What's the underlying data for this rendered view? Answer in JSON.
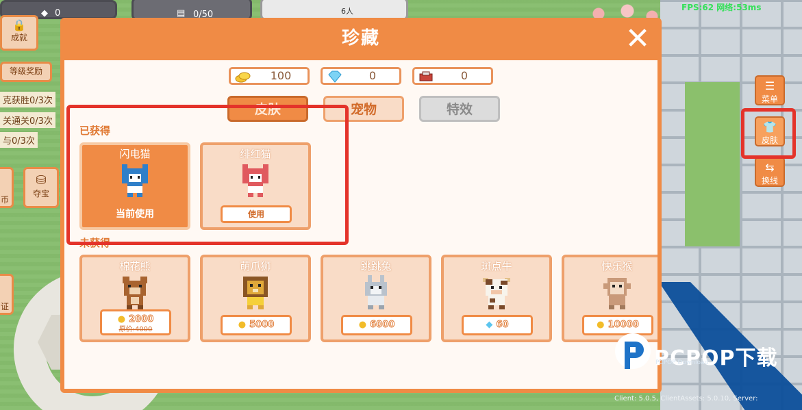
{
  "hud": {
    "achievement_label": "成就",
    "level_reward": "等级奖励",
    "quests": [
      "克获胜0/3次",
      "关通关0/3次",
      "与0/3次"
    ],
    "treasure_label": "夺宝",
    "side_label_1": "币",
    "side_label_2": "证",
    "top_counter": "0/50",
    "top_players": "6人",
    "top_num": "0",
    "fps": "FPS:62 网络:53ms",
    "version": "Client: 5.0.5, ClientAssets: 5.0.10, Server:"
  },
  "right_menu": [
    {
      "label": "菜单",
      "icon": "menu-icon"
    },
    {
      "label": "皮肤",
      "icon": "shirt-icon"
    },
    {
      "label": "换线",
      "icon": "switch-icon"
    }
  ],
  "modal": {
    "title": "珍藏",
    "currencies": [
      {
        "icon": "coin-icon",
        "value": "100"
      },
      {
        "icon": "diamond-icon",
        "value": "0"
      },
      {
        "icon": "ticket-icon",
        "value": "0"
      }
    ],
    "tabs": [
      "皮肤",
      "宠物",
      "特效"
    ],
    "owned_title": "已获得",
    "unowned_title": "未获得",
    "owned": [
      {
        "name": "闪电猫",
        "status": "当前使用",
        "color": "#2f7fc9"
      },
      {
        "name": "绯红猫",
        "action": "使用",
        "color": "#e05a5f"
      }
    ],
    "unowned": [
      {
        "name": "棉花熊",
        "price": "2000",
        "original": "原价:4000",
        "currency": "coin",
        "color": "#a8632f"
      },
      {
        "name": "萌爪狮",
        "price": "5000",
        "currency": "coin",
        "color": "#e0a83a"
      },
      {
        "name": "跳跳兔",
        "price": "6000",
        "currency": "coin",
        "color": "#b9c2cc"
      },
      {
        "name": "斑点牛",
        "price": "60",
        "currency": "diamond",
        "color": "#7a4a2a"
      },
      {
        "name": "快乐猴",
        "price": "10000",
        "currency": "coin",
        "color": "#c99a7a"
      }
    ]
  },
  "watermark": {
    "brand": "PCPOP下载",
    "sub": "PCPOP Download"
  }
}
